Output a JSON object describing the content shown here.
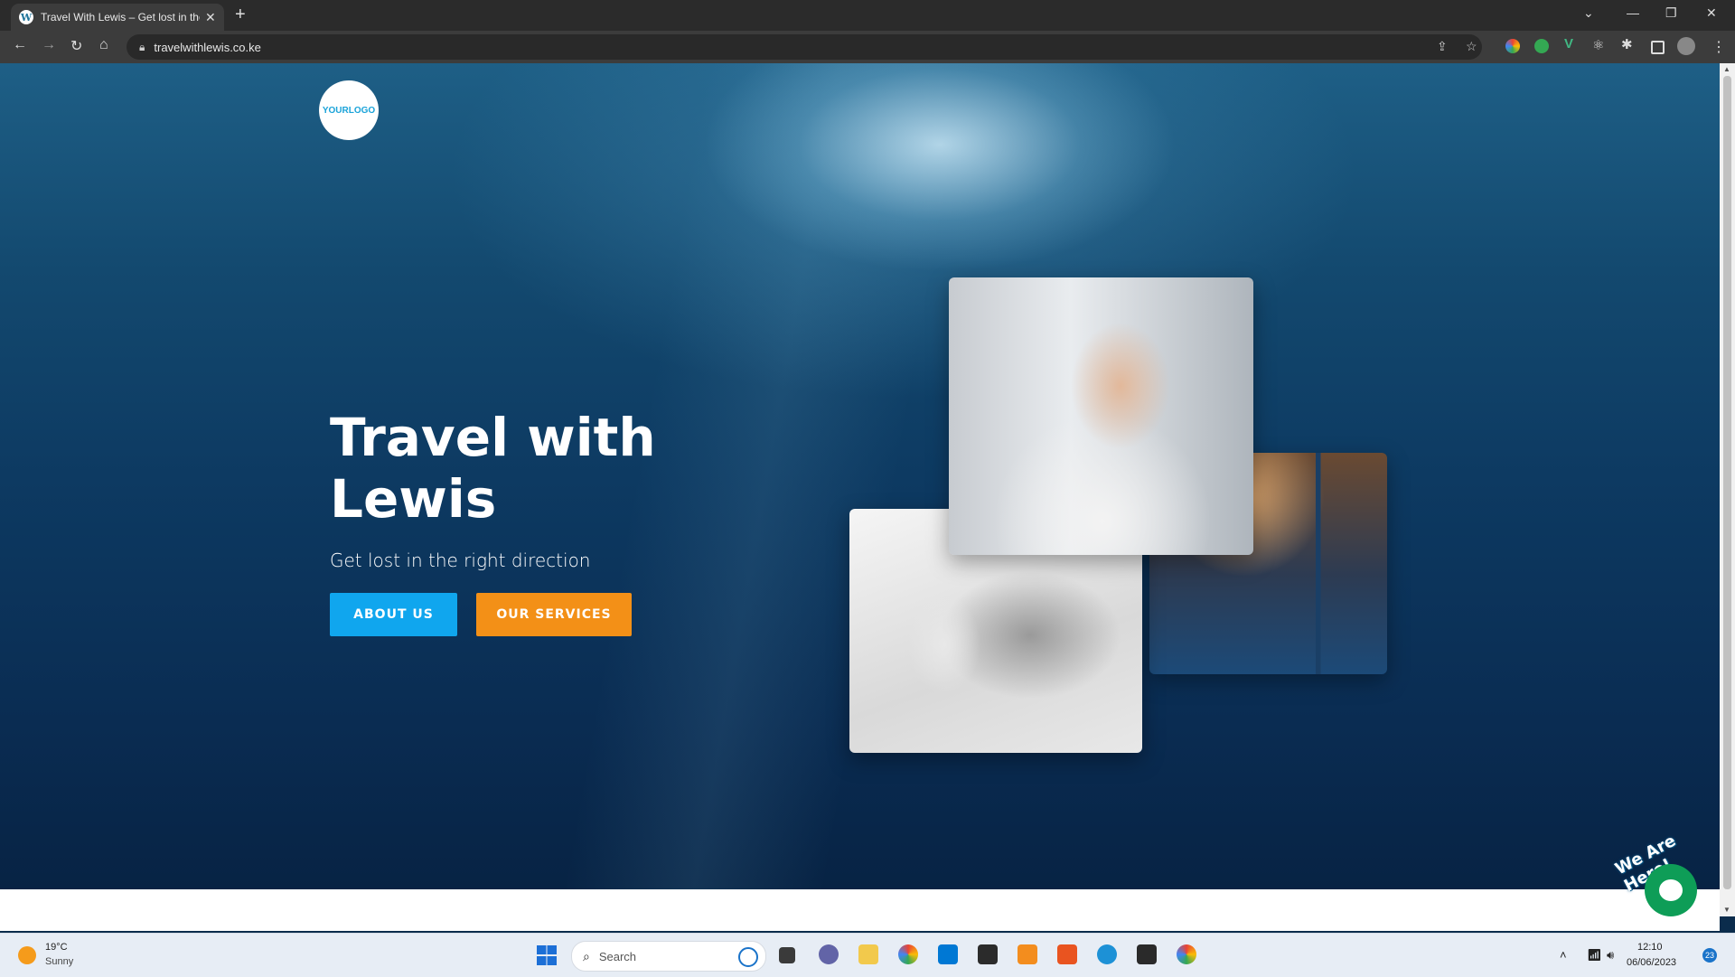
{
  "browser": {
    "tab_title": "Travel With Lewis – Get lost in the right direction",
    "url": "travelwithlewis.co.ke"
  },
  "site": {
    "logo_text": "YOURLOGO",
    "hero_title": "Travel with Lewis",
    "hero_subtitle": "Get lost in the right direction",
    "about_button": "ABOUT US",
    "services_button": "OUR SERVICES",
    "chat_label": "We Are Here!"
  },
  "colors": {
    "about_button_bg": "#10a6ee",
    "services_button_bg": "#f39017",
    "chat_bubble": "#0e9d57"
  },
  "taskbar": {
    "weather_temp": "19°C",
    "weather_desc": "Sunny",
    "search_placeholder": "Search",
    "time": "12:10",
    "date": "06/06/2023",
    "notification_count": "23"
  }
}
